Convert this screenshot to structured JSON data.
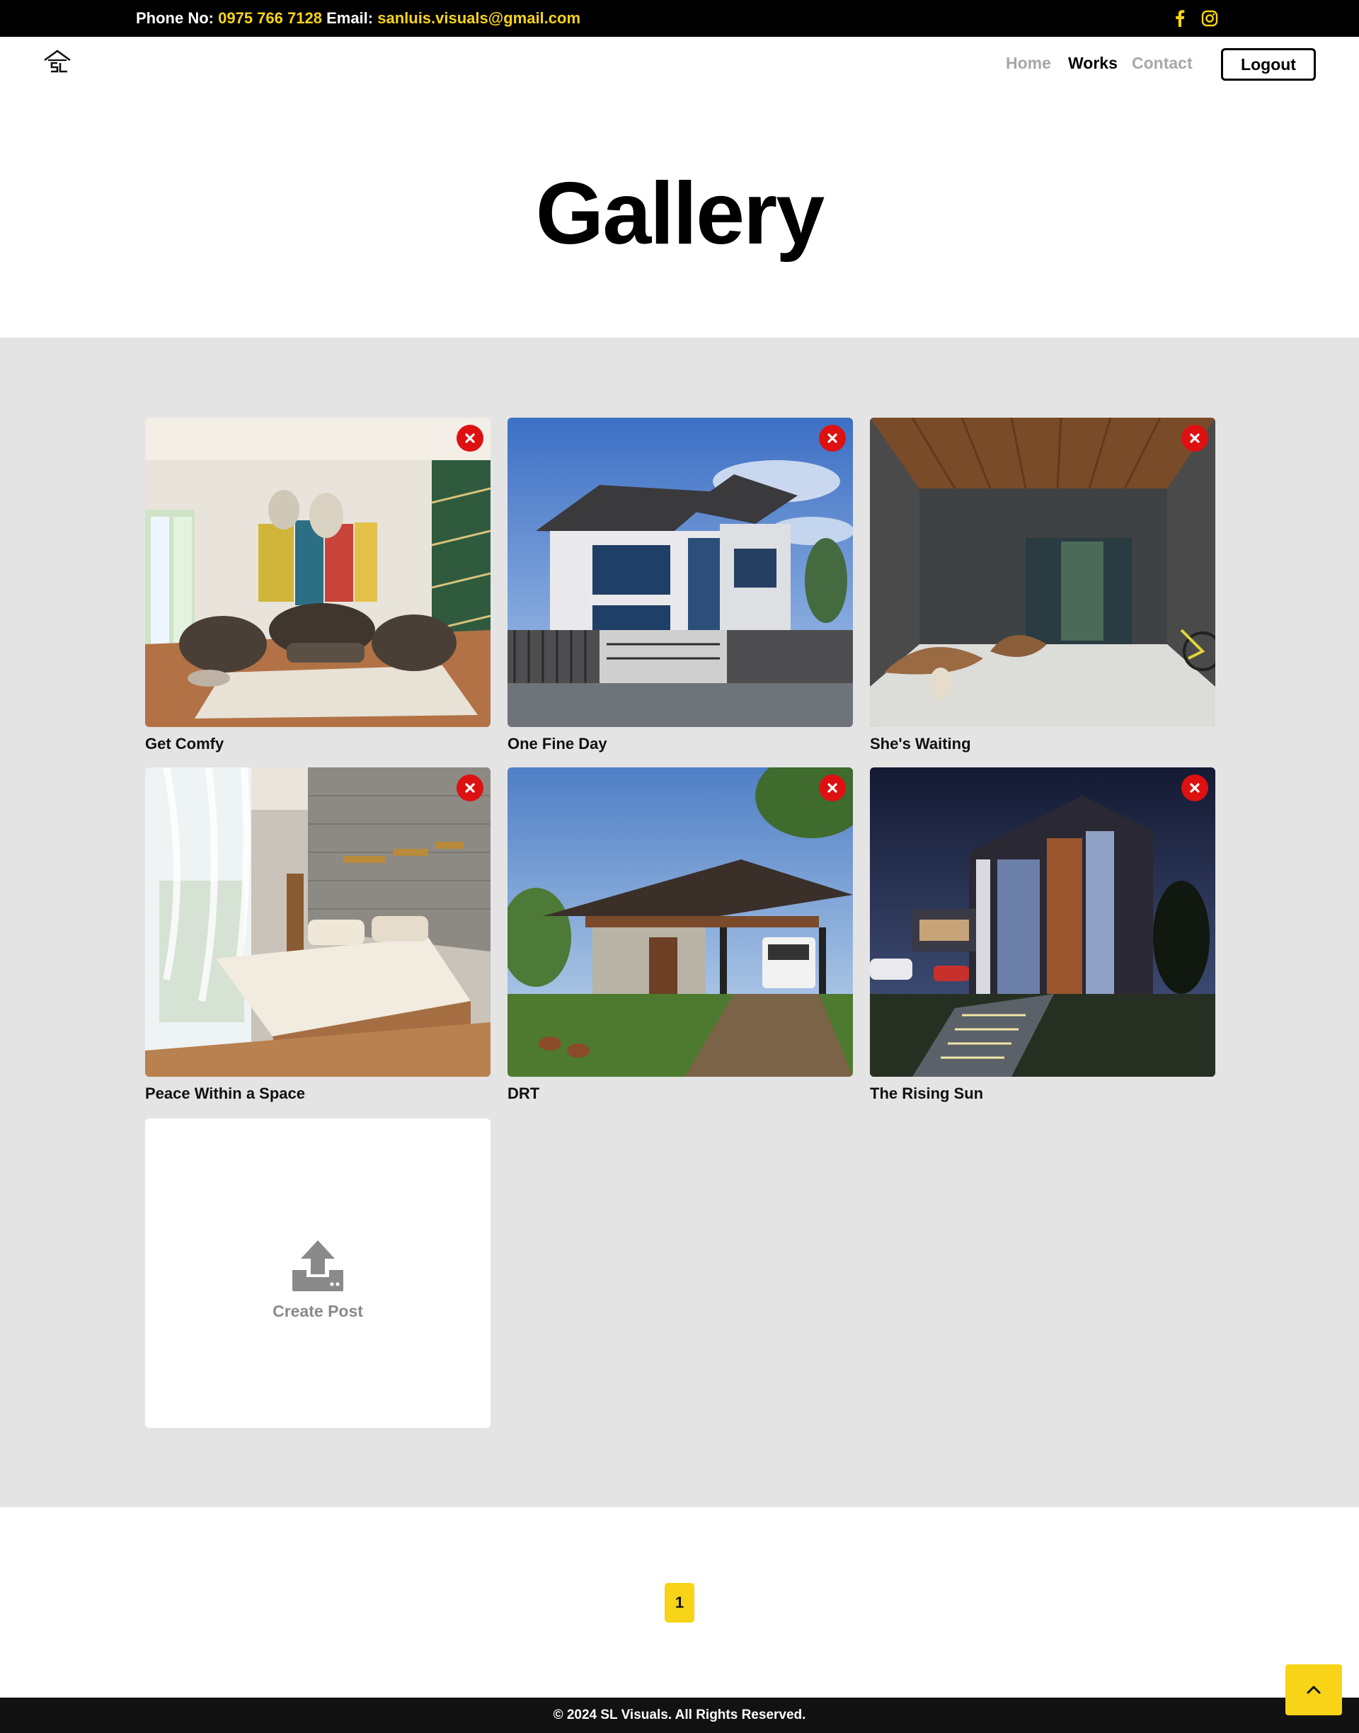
{
  "topbar": {
    "phone_label": "Phone No:",
    "phone_value": "0975 766 7128",
    "email_label": "Email:",
    "email_value": "sanluis.visuals@gmail.com",
    "icons": [
      "facebook-icon",
      "instagram-icon"
    ]
  },
  "nav": {
    "logo_icon": "house-logo-icon",
    "links": [
      {
        "label": "Home",
        "active": false
      },
      {
        "label": "Works",
        "active": true
      },
      {
        "label": "Contact",
        "active": false
      }
    ],
    "logout_label": "Logout"
  },
  "page": {
    "title": "Gallery"
  },
  "gallery": {
    "items": [
      {
        "title": "Get Comfy"
      },
      {
        "title": "One Fine Day"
      },
      {
        "title": "She's Waiting"
      },
      {
        "title": "Peace Within a Space"
      },
      {
        "title": "DRT"
      },
      {
        "title": "The Rising Sun"
      }
    ],
    "create_label": "Create Post"
  },
  "pagination": {
    "current_page": "1"
  },
  "footer": {
    "copyright": "© 2024 SL Visuals. All Rights Reserved."
  },
  "colors": {
    "accent": "#f7d417",
    "topbar_bg": "#000000",
    "gallery_bg": "#e4e4e4",
    "delete": "#dd1111",
    "footer_bg": "#121212"
  }
}
